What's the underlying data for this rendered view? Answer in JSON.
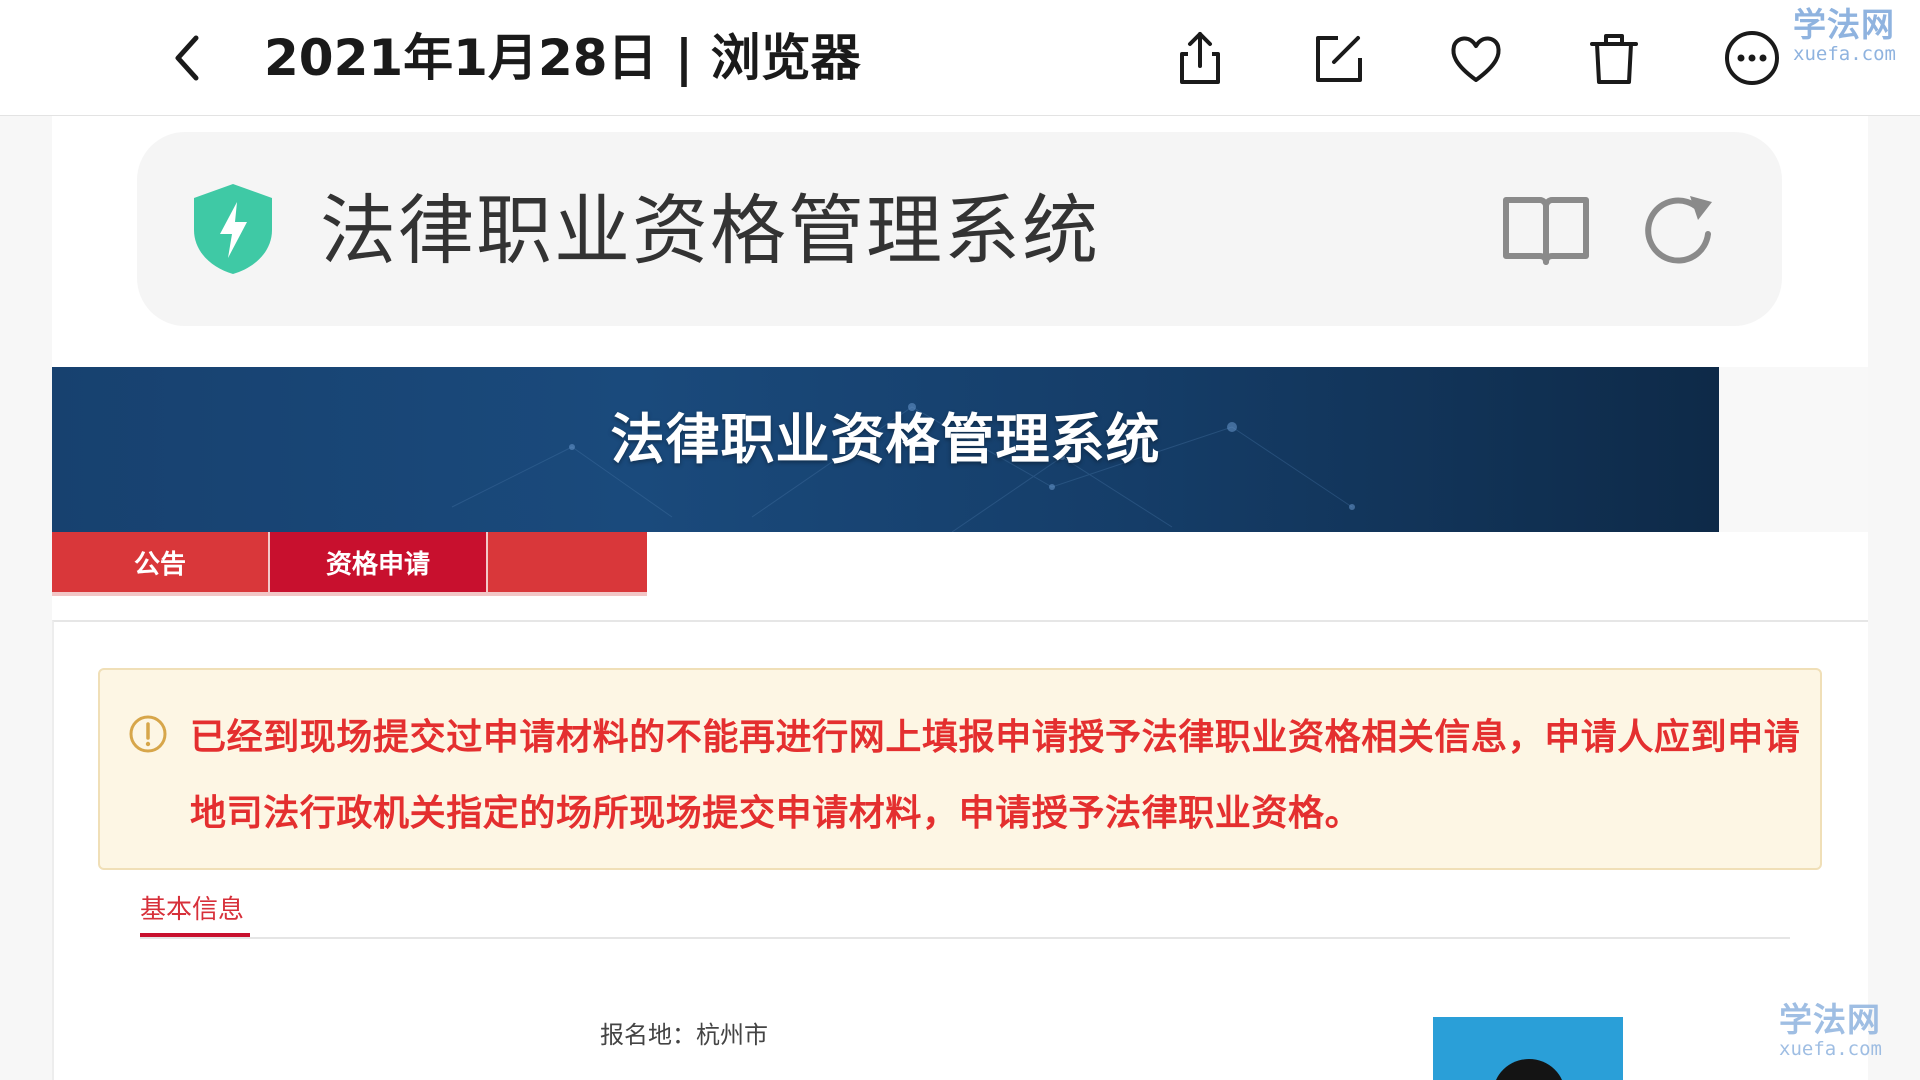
{
  "viewer": {
    "title": "2021年1月28日 | 浏览器",
    "watermark_cn": "学法网",
    "watermark_en": "xuefa.com",
    "icons": [
      "back-icon",
      "share-icon",
      "edit-icon",
      "heart-icon",
      "delete-icon",
      "more-icon"
    ]
  },
  "browser": {
    "address_title": "法律职业资格管理系统",
    "icons": [
      "shield-icon",
      "reader-mode-icon",
      "reload-icon"
    ]
  },
  "site": {
    "banner_title": "法律职业资格管理系统",
    "nav": [
      "公告",
      "资格申请"
    ],
    "active_nav": "资格申请",
    "alert_text": "已经到现场提交过申请材料的不能再进行网上填报申请授予法律职业资格相关信息，申请人应到申请地司法行政机关指定的场所现场提交申请材料，申请授予法律职业资格。",
    "tab": "基本信息",
    "field_registration_place": "报名地：杭州市"
  },
  "colors": {
    "nav_red": "#d9373a",
    "nav_active": "#c8102e",
    "alert_text": "#e42f2f",
    "alert_bg": "#fdf6e4",
    "banner": "#17416f",
    "shield": "#3fc9a5",
    "watermark": "#8fb3df"
  }
}
